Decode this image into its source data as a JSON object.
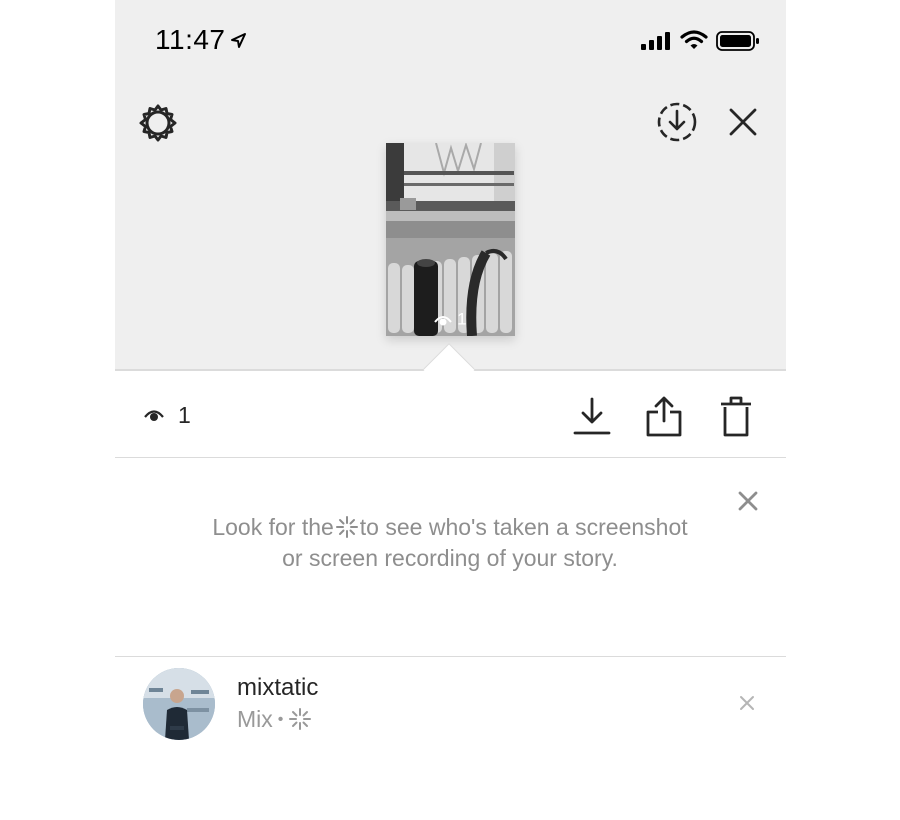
{
  "status_bar": {
    "time": "11:47"
  },
  "story": {
    "thumbnail_views": "1"
  },
  "actions": {
    "views_count": "1"
  },
  "tip": {
    "text_before": "Look for the",
    "text_after": "to see who's taken a screenshot or screen recording of your story."
  },
  "viewer": {
    "username": "mixtatic",
    "name": "Mix",
    "separator": "•"
  },
  "colors": {
    "top_background": "#efefef",
    "divider": "#dbdbdb",
    "secondary_text": "#8e8e8e"
  }
}
